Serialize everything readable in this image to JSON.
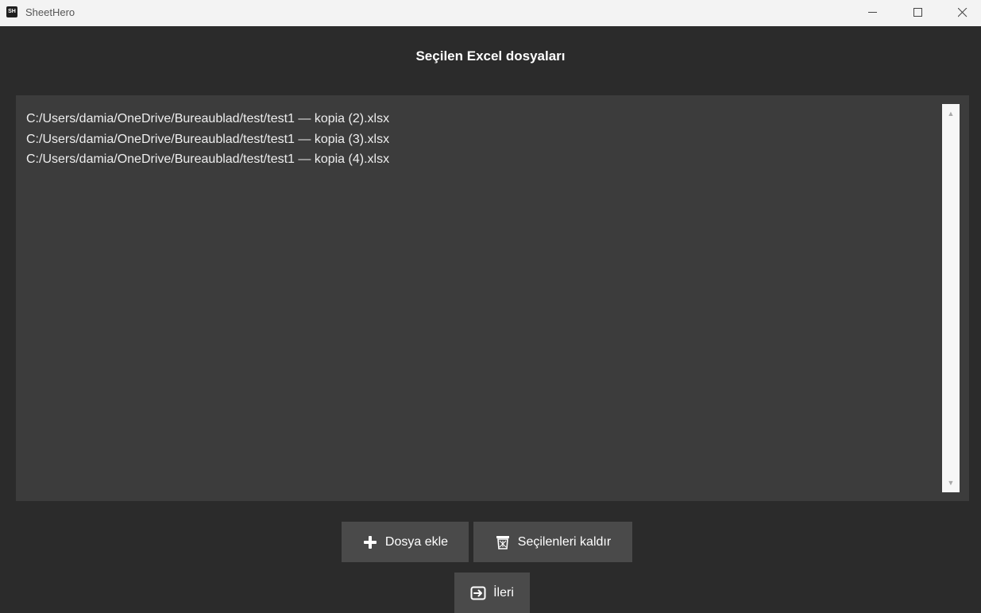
{
  "window": {
    "app_icon_text": "SH",
    "title": "SheetHero"
  },
  "main": {
    "title": "Seçilen Excel dosyaları",
    "files": [
      "C:/Users/damia/OneDrive/Bureaublad/test/test1 — kopia (2).xlsx",
      "C:/Users/damia/OneDrive/Bureaublad/test/test1 — kopia (3).xlsx",
      "C:/Users/damia/OneDrive/Bureaublad/test/test1 — kopia (4).xlsx"
    ]
  },
  "buttons": {
    "add_label": "Dosya ekle",
    "add_icon": "plus-icon",
    "remove_label": "Seçilenleri kaldır",
    "remove_icon": "trash-icon",
    "next_label": "İleri",
    "next_icon": "arrow-right-box-icon"
  },
  "colors": {
    "background": "#2b2b2b",
    "listbox": "#3c3c3c",
    "button": "#4a4a4a",
    "text": "#ffffff"
  }
}
